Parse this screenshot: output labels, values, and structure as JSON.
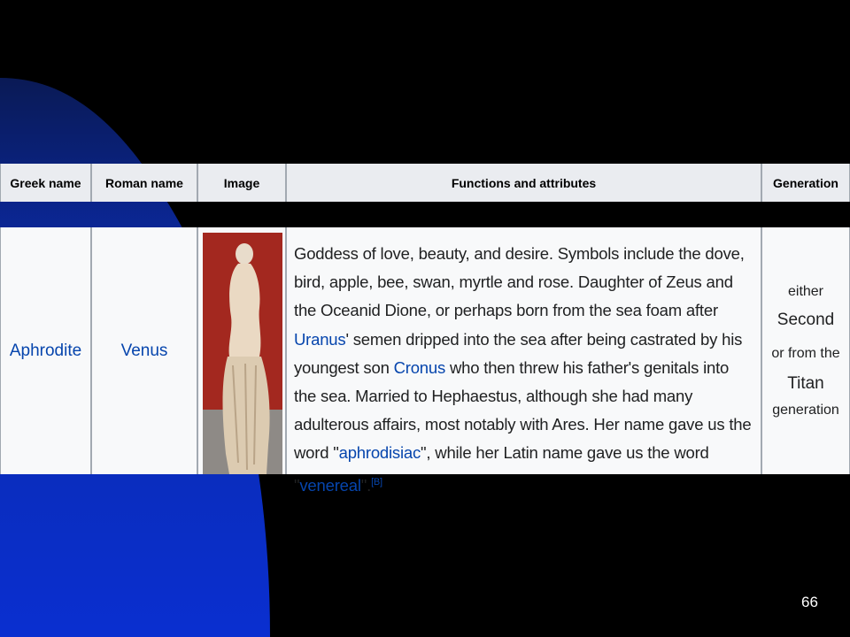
{
  "table": {
    "headers": [
      "Greek name",
      "Roman name",
      "Image",
      "Functions and attributes",
      "Generation"
    ],
    "row": {
      "greek": "Aphrodite",
      "roman": "Venus",
      "image_alt": "Statue of Aphrodite",
      "description": {
        "t1": "Goddess of love, beauty, and desire. Symbols include the dove, bird, apple, bee, swan, myrtle and rose. Daughter of Zeus and the Oceanid Dione, or perhaps born from the sea foam after ",
        "link1": "Uranus",
        "t2": "' semen dripped into the sea after being castrated by his youngest son ",
        "link2": "Cronus",
        "t3": " who then threw his father's genitals into the sea. Married to Hephaestus, although she had many adulterous affairs, most notably with Ares. Her name gave us the word \"",
        "link3": "aphrodisiac",
        "t4": "\", while her Latin name gave us the word \"",
        "link4": "venereal",
        "t5": "\".",
        "ref": "[B]"
      },
      "generation": [
        "either",
        "Second",
        "or from the",
        "Titan",
        "generation"
      ]
    }
  },
  "slide_number": "66",
  "colors": {
    "background": "#000000",
    "accent_blue": "#0033cc",
    "link": "#0645ad"
  }
}
